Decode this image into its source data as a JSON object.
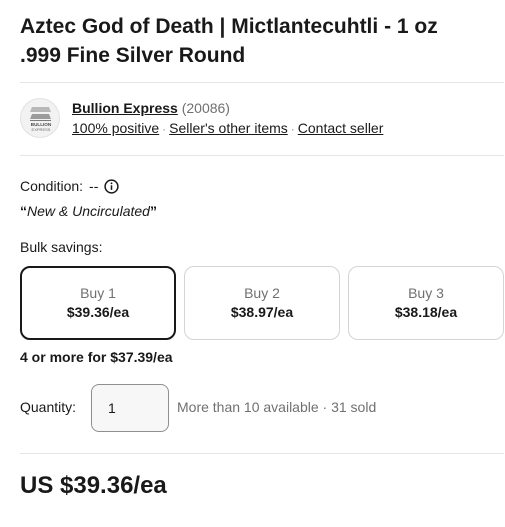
{
  "listing": {
    "title_line1": "Aztec God of Death | Mictlantecuhtli - 1 oz",
    "title_line2": ".999 Fine Silver Round"
  },
  "seller": {
    "logo_text_1": "BULLION",
    "logo_text_2": "EXPRESS",
    "name": "Bullion Express",
    "feedback_count": "(20086)",
    "positive": "100% positive",
    "other_items": "Seller's other items",
    "contact": "Contact seller",
    "separator": "·"
  },
  "condition": {
    "label": "Condition:",
    "value": "--",
    "quote_open": "“",
    "note": "New & Uncirculated",
    "quote_close": "”"
  },
  "bulk": {
    "label": "Bulk savings:",
    "tiers": [
      {
        "label": "Buy 1",
        "price": "$39.36/ea",
        "selected": true
      },
      {
        "label": "Buy 2",
        "price": "$38.97/ea",
        "selected": false
      },
      {
        "label": "Buy 3",
        "price": "$38.18/ea",
        "selected": false
      }
    ],
    "more_note": "4 or more for $37.39/ea"
  },
  "quantity": {
    "label": "Quantity:",
    "value": "1",
    "availability": "More than 10 available · 31 sold"
  },
  "price": {
    "display": "US $39.36/ea"
  }
}
